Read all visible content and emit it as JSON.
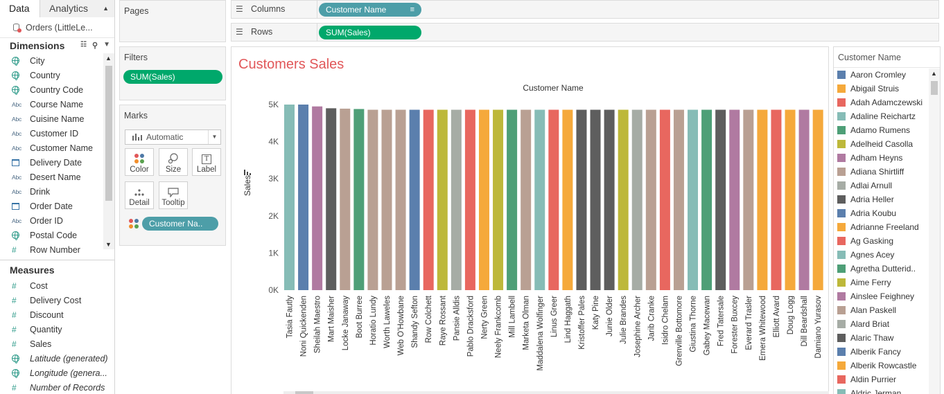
{
  "data_pane": {
    "tabs": [
      {
        "label": "Data"
      },
      {
        "label": "Analytics"
      }
    ],
    "datasource": "Orders (LittleLe...",
    "dimensions_title": "Dimensions",
    "dimensions": [
      {
        "label": "City",
        "type": "geo"
      },
      {
        "label": "Country",
        "type": "geo"
      },
      {
        "label": "Country Code",
        "type": "geo"
      },
      {
        "label": "Course Name",
        "type": "string"
      },
      {
        "label": "Cuisine Name",
        "type": "string"
      },
      {
        "label": "Customer ID",
        "type": "string"
      },
      {
        "label": "Customer Name",
        "type": "string"
      },
      {
        "label": "Delivery Date",
        "type": "date"
      },
      {
        "label": "Desert Name",
        "type": "string"
      },
      {
        "label": "Drink",
        "type": "string"
      },
      {
        "label": "Order Date",
        "type": "date"
      },
      {
        "label": "Order ID",
        "type": "string"
      },
      {
        "label": "Postal Code",
        "type": "geo"
      },
      {
        "label": "Row Number",
        "type": "number"
      }
    ],
    "measures_title": "Measures",
    "measures": [
      {
        "label": "Cost",
        "type": "number",
        "italic": false
      },
      {
        "label": "Delivery Cost",
        "type": "number",
        "italic": false
      },
      {
        "label": "Discount",
        "type": "number",
        "italic": false
      },
      {
        "label": "Quantity",
        "type": "number",
        "italic": false
      },
      {
        "label": "Sales",
        "type": "number",
        "italic": false
      },
      {
        "label": "Latitude (generated)",
        "type": "geo",
        "italic": true
      },
      {
        "label": "Longitude (genera...",
        "type": "geo",
        "italic": true
      },
      {
        "label": "Number of Records",
        "type": "number",
        "italic": true
      }
    ],
    "abc_glyph": "Abc",
    "hash_glyph": "#"
  },
  "pages": {
    "title": "Pages"
  },
  "filters": {
    "title": "Filters",
    "pill": "SUM(Sales)"
  },
  "marks": {
    "title": "Marks",
    "mark_type": "Automatic",
    "buttons": {
      "color": "Color",
      "size": "Size",
      "label": "Label",
      "detail": "Detail",
      "tooltip": "Tooltip"
    },
    "label_icon_glyph": "T",
    "pill": "Customer Na.."
  },
  "shelves": {
    "columns_label": "Columns",
    "columns_pill": "Customer Name",
    "rows_label": "Rows",
    "rows_pill": "SUM(Sales)"
  },
  "legend": {
    "title": "Customer Name"
  },
  "colors": {
    "accent_green": "#00a86b",
    "pill_blue": "#4d9ea8",
    "title_red": "#e15759"
  },
  "chart_data": {
    "type": "bar",
    "title": "Customers Sales",
    "x_header": "Customer Name",
    "ylabel": "Sales",
    "ylim": [
      0,
      5000
    ],
    "y_ticks": [
      0,
      1000,
      2000,
      3000,
      4000,
      5000
    ],
    "y_tick_labels": [
      "0K",
      "1K",
      "2K",
      "3K",
      "4K",
      "5K"
    ],
    "categories": [
      "Tasia Fautly",
      "Noni Quickenden",
      "Sheilah Maestro",
      "Mart Maisher",
      "Locke Janaway",
      "Boot Burree",
      "Horatio Lundy",
      "Worth Laweles",
      "Web O'Howbane",
      "Shandy Sefton",
      "Row Colchett",
      "Raye Rossant",
      "Pansie Alldis",
      "Pablo Dracksford",
      "Nerty Green",
      "Neely Frankcomb",
      "Mill Lambell",
      "Marketa Olman",
      "Maddalena Wolfinger",
      "Linus Greer",
      "Lind Haggath",
      "Kristoffer Pales",
      "Katy Pine",
      "Junie Older",
      "Julie Brandes",
      "Josephine Archer",
      "Jarib Cranke",
      "Isidro Chelam",
      "Grenville Bottomore",
      "Giustina Thorne",
      "Gabey Macewan",
      "Fred Tatersale",
      "Forester Buxcey",
      "Everard Trasler",
      "Emera Whitewood",
      "Elliott Avard",
      "Doug Logg",
      "Dill Beardshall",
      "Damiano Yurasov"
    ],
    "values": [
      5000,
      5000,
      4950,
      4900,
      4890,
      4880,
      4860,
      4860,
      4860,
      4860,
      4860,
      4860,
      4860,
      4860,
      4860,
      4860,
      4860,
      4860,
      4860,
      4860,
      4860,
      4860,
      4860,
      4860,
      4860,
      4860,
      4860,
      4860,
      4860,
      4860,
      4860,
      4860,
      4860,
      4860,
      4860,
      4860,
      4860,
      4860,
      4860
    ],
    "bar_colors": [
      "#86bcb6",
      "#5b7fad",
      "#b07aa1",
      "#5e5e5e",
      "#b9a093",
      "#4e9f77",
      "#b9a093",
      "#b9a093",
      "#b9a093",
      "#5b7fad",
      "#e8675f",
      "#bdb83a",
      "#a6aca5",
      "#e8675f",
      "#f5a93b",
      "#bdb83a",
      "#4e9f77",
      "#b9a093",
      "#86bcb6",
      "#e8675f",
      "#f5a93b",
      "#5e5e5e",
      "#5e5e5e",
      "#5e5e5e",
      "#bdb83a",
      "#a6aca5",
      "#b9a093",
      "#e8675f",
      "#b9a093",
      "#86bcb6",
      "#4e9f77",
      "#5e5e5e",
      "#b07aa1",
      "#b9a093",
      "#f5a93b",
      "#e8675f",
      "#f5a93b",
      "#b07aa1",
      "#f5a93b"
    ],
    "grid": false
  },
  "legend_items": [
    {
      "label": "Aaron Cromley",
      "color": "#5b7fad"
    },
    {
      "label": "Abigail Struis",
      "color": "#f5a93b"
    },
    {
      "label": "Adah Adamczewski",
      "color": "#e8675f"
    },
    {
      "label": "Adaline Reichartz",
      "color": "#86bcb6"
    },
    {
      "label": "Adamo Rumens",
      "color": "#4e9f77"
    },
    {
      "label": "Adelheid Casolla",
      "color": "#bdb83a"
    },
    {
      "label": "Adham Heyns",
      "color": "#b07aa1"
    },
    {
      "label": "Adiana Shirtliff",
      "color": "#b9a093"
    },
    {
      "label": "Adlai Arnull",
      "color": "#a6aca5"
    },
    {
      "label": "Adria Heller",
      "color": "#5e5e5e"
    },
    {
      "label": "Adria Koubu",
      "color": "#5b7fad"
    },
    {
      "label": "Adrianne Freeland",
      "color": "#f5a93b"
    },
    {
      "label": "Ag Gasking",
      "color": "#e8675f"
    },
    {
      "label": "Agnes Acey",
      "color": "#86bcb6"
    },
    {
      "label": "Agretha Dutterid..",
      "color": "#4e9f77"
    },
    {
      "label": "Aime Ferry",
      "color": "#bdb83a"
    },
    {
      "label": "Ainslee Feighney",
      "color": "#b07aa1"
    },
    {
      "label": "Alan Paskell",
      "color": "#b9a093"
    },
    {
      "label": "Alard Briat",
      "color": "#a6aca5"
    },
    {
      "label": "Alaric Thaw",
      "color": "#5e5e5e"
    },
    {
      "label": "Alberik Fancy",
      "color": "#5b7fad"
    },
    {
      "label": "Alberik Rowcastle",
      "color": "#f5a93b"
    },
    {
      "label": "Aldin Purrier",
      "color": "#e8675f"
    },
    {
      "label": "Aldric Jerman",
      "color": "#86bcb6"
    }
  ]
}
